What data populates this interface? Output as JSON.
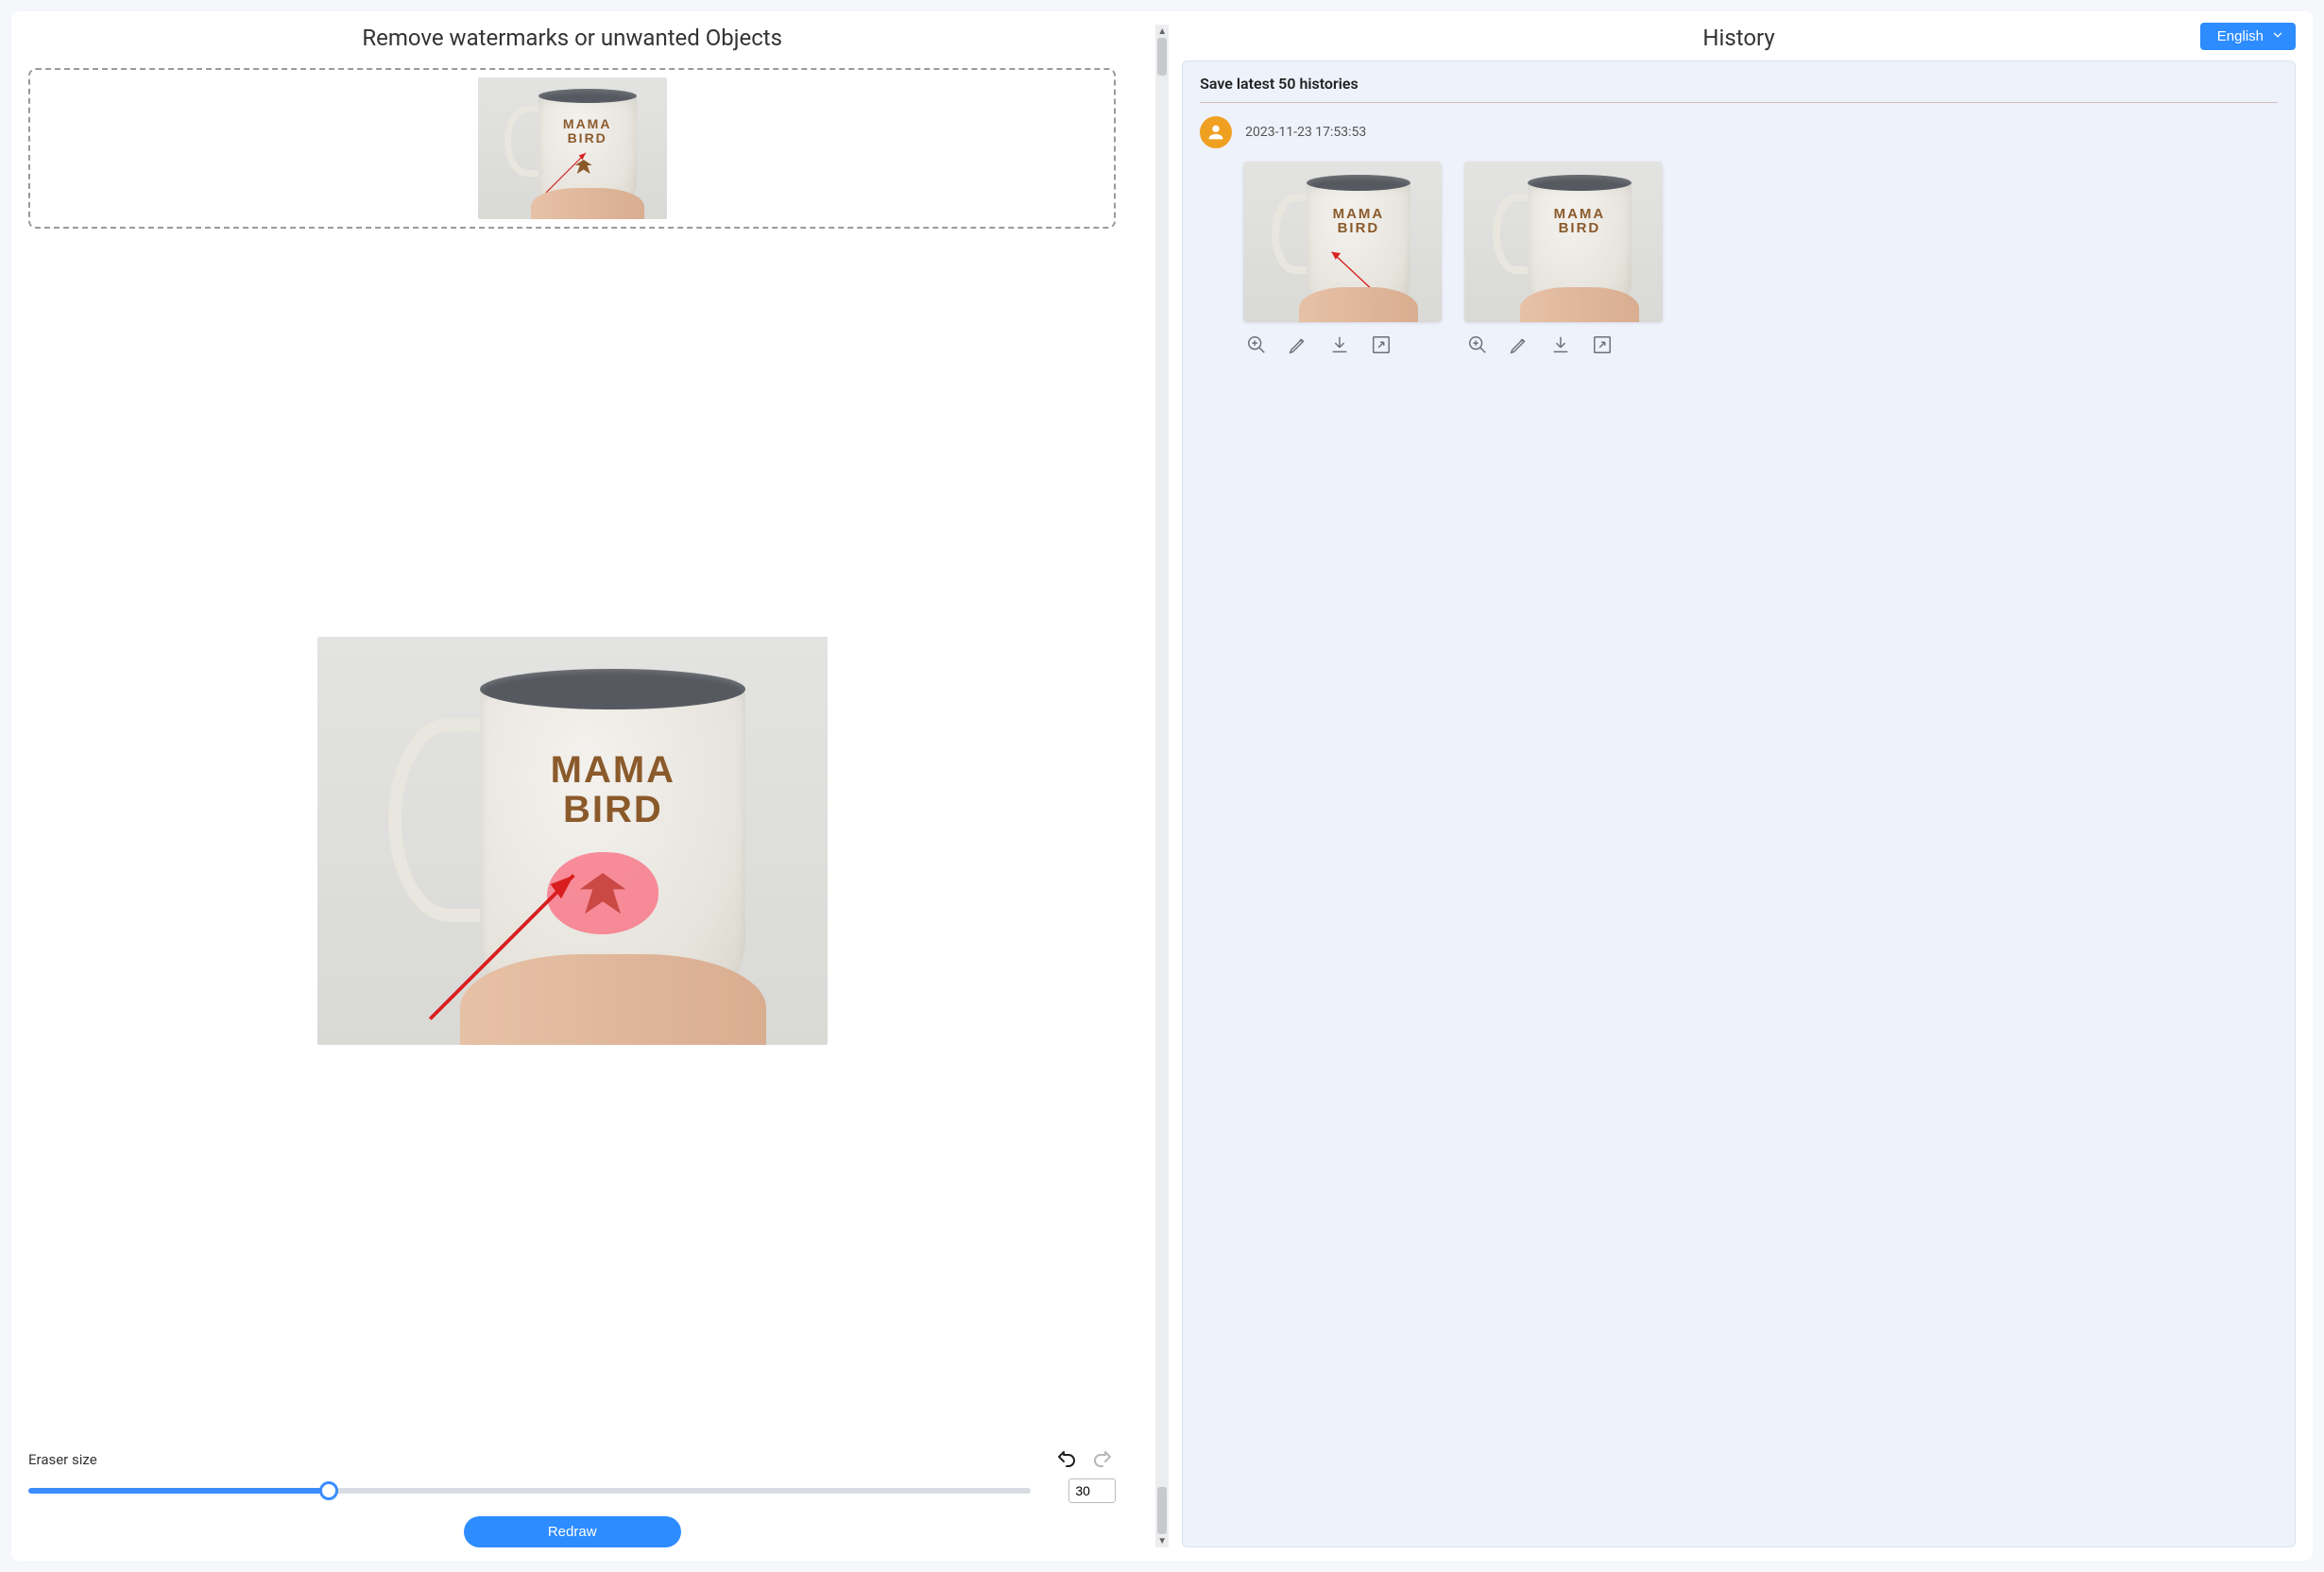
{
  "left": {
    "title": "Remove watermarks or unwanted Objects",
    "mug_text_line1": "MAMA",
    "mug_text_line2": "BIRD",
    "eraser_label": "Eraser size",
    "eraser_value": "30",
    "eraser_percent": 30,
    "redraw_label": "Redraw",
    "undo_icon": "undo-icon",
    "redo_icon": "redo-icon"
  },
  "right": {
    "title": "History",
    "language": "English",
    "subheading": "Save latest 50 histories",
    "entries": [
      {
        "timestamp": "2023-11-23 17:53:53",
        "images": [
          {
            "mug_line1": "MAMA",
            "mug_line2": "BIRD",
            "has_bird": false,
            "has_arrow": true
          },
          {
            "mug_line1": "MAMA",
            "mug_line2": "BIRD",
            "has_bird": false,
            "has_arrow": false
          }
        ]
      }
    ],
    "card_actions": {
      "zoom": "zoom-in-icon",
      "edit": "pencil-icon",
      "download": "download-icon",
      "expand": "expand-icon"
    }
  }
}
